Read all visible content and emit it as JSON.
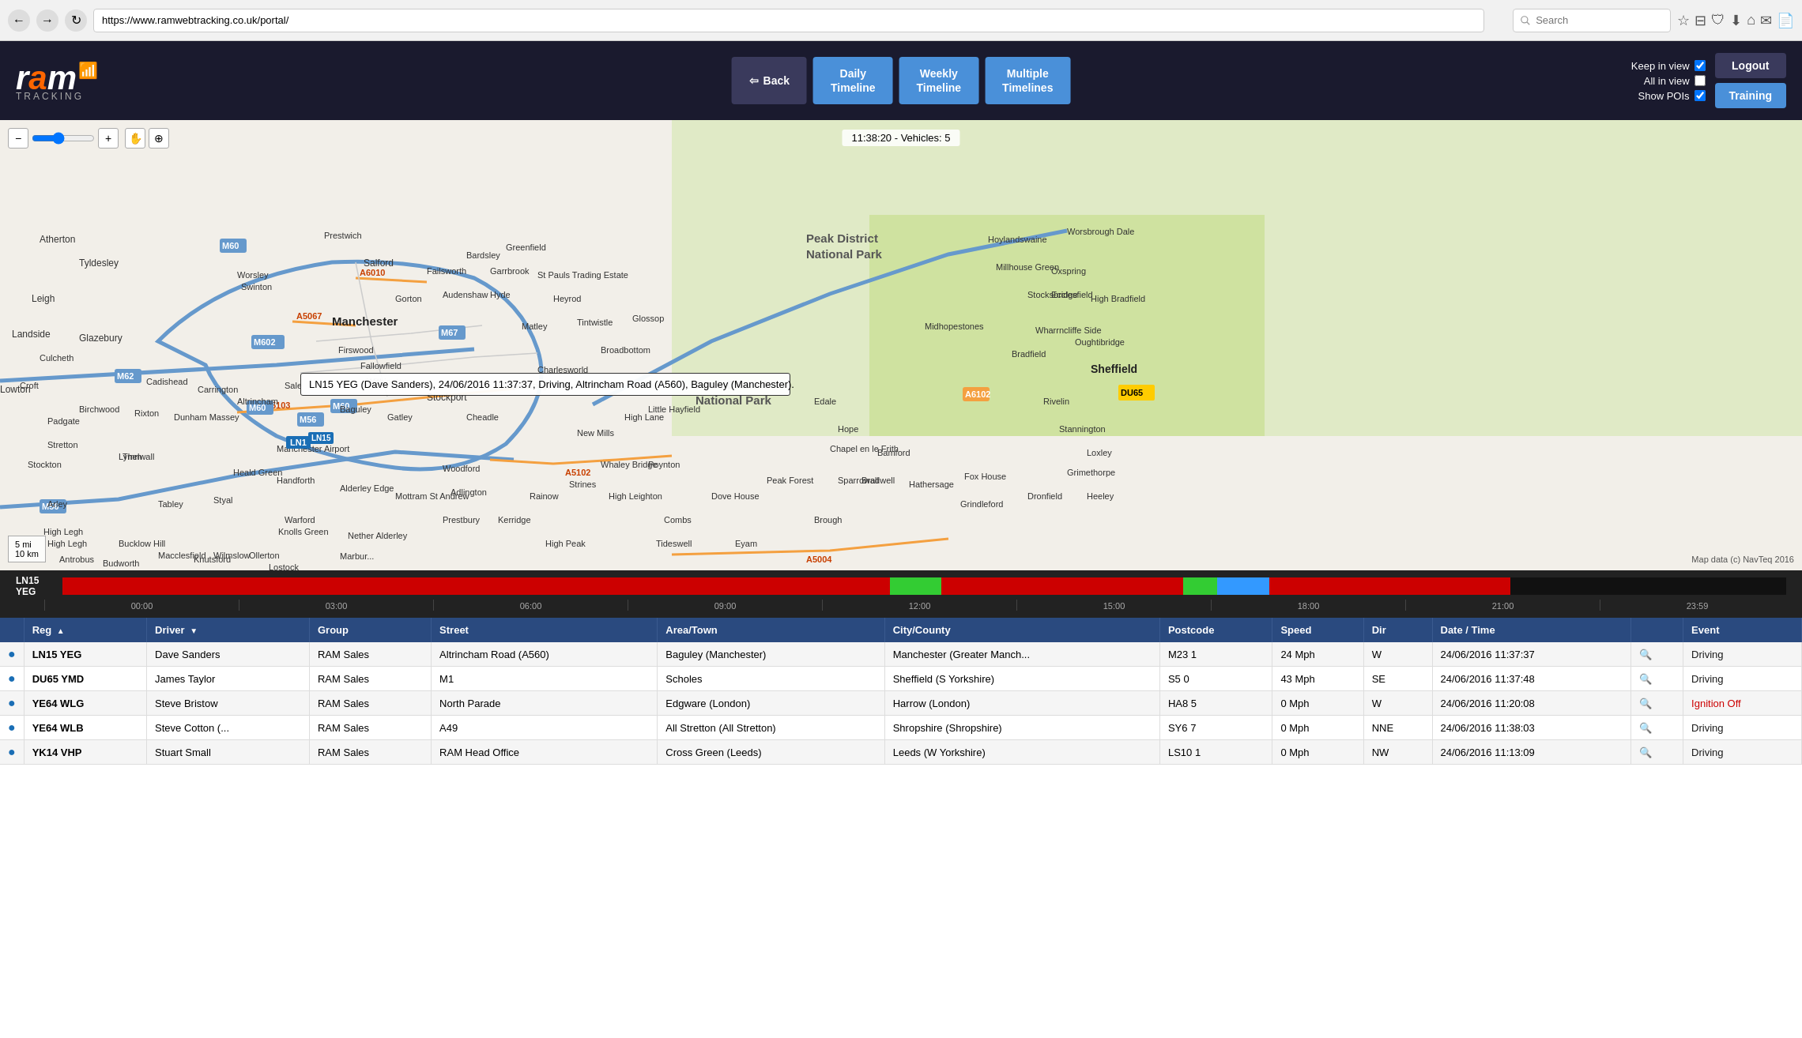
{
  "browser": {
    "url": "https://www.ramwebtracking.co.uk/portal/",
    "search_placeholder": "Search"
  },
  "header": {
    "logo_ram": "ram",
    "logo_tracking": "TRACKING",
    "back_label": "Back",
    "daily_label": "Daily\nTimeline",
    "weekly_label": "Weekly\nTimeline",
    "multiple_label": "Multiple\nTimelines",
    "keep_in_view": "Keep in view",
    "all_in_view": "All in view",
    "show_pois": "Show POIs",
    "logout_label": "Logout",
    "training_label": "Training"
  },
  "status_bar": {
    "text": "11:38:20 - Vehicles: 5"
  },
  "map": {
    "tooltip": "LN15 YEG (Dave Sanders), 24/06/2016 11:37:37, Driving, Altrincham Road (A560), Baguley (Manchester).",
    "tooltip_label": "LN1",
    "vehicle_marker_1": "DU65",
    "vehicle_marker_2": "LN15",
    "scale_text_1": "5 mi",
    "scale_text_2": "10 km",
    "credit": "Map data (c) NavTeq 2016"
  },
  "timeline": {
    "vehicle": "LN15\nYEG",
    "hours": [
      "00:00",
      "03:00",
      "06:00",
      "09:00",
      "12:00",
      "15:00",
      "18:00",
      "21:00",
      "23:59"
    ]
  },
  "table": {
    "columns": [
      "",
      "Reg",
      "Driver",
      "Group",
      "Street",
      "Area/Town",
      "City/County",
      "Postcode",
      "Speed",
      "Dir",
      "Date / Time",
      "",
      "Event"
    ],
    "rows": [
      {
        "icon": "●",
        "reg": "LN15 YEG",
        "driver": "Dave Sanders",
        "group": "RAM Sales",
        "street": "Altrincham Road (A560)",
        "area": "Baguley (Manchester)",
        "city": "Manchester (Greater Manch...",
        "postcode": "M23 1",
        "speed": "24 Mph",
        "dir": "W",
        "datetime": "24/06/2016   11:37:37",
        "speed_icon": "🔍",
        "event": "Driving",
        "event_class": "event-driving"
      },
      {
        "icon": "●",
        "reg": "DU65 YMD",
        "driver": "James Taylor",
        "group": "RAM Sales",
        "street": "M1",
        "area": "Scholes",
        "city": "Sheffield (S Yorkshire)",
        "postcode": "S5 0",
        "speed": "43 Mph",
        "dir": "SE",
        "datetime": "24/06/2016   11:37:48",
        "speed_icon": "🔍",
        "event": "Driving",
        "event_class": "event-driving"
      },
      {
        "icon": "●",
        "reg": "YE64 WLG",
        "driver": "Steve Bristow",
        "group": "RAM Sales",
        "street": "North Parade",
        "area": "Edgware (London)",
        "city": "Harrow (London)",
        "postcode": "HA8 5",
        "speed": "0 Mph",
        "dir": "W",
        "datetime": "24/06/2016   11:20:08",
        "speed_icon": "🔍",
        "event": "Ignition Off",
        "event_class": "event-ignition"
      },
      {
        "icon": "●",
        "reg": "YE64 WLB",
        "driver": "Steve Cotton (...",
        "group": "RAM Sales",
        "street": "A49",
        "area": "All Stretton (All Stretton)",
        "city": "Shropshire (Shropshire)",
        "postcode": "SY6 7",
        "speed": "0 Mph",
        "dir": "NNE",
        "datetime": "24/06/2016   11:38:03",
        "speed_icon": "🔍",
        "event": "Driving",
        "event_class": "event-driving"
      },
      {
        "icon": "●",
        "reg": "YK14 VHP",
        "driver": "Stuart Small",
        "group": "RAM Sales",
        "street": "RAM Head Office",
        "area": "Cross Green (Leeds)",
        "city": "Leeds (W Yorkshire)",
        "postcode": "LS10 1",
        "speed": "0 Mph",
        "dir": "NW",
        "datetime": "24/06/2016   11:13:09",
        "speed_icon": "🔍",
        "event": "Driving",
        "event_class": "event-driving"
      }
    ]
  },
  "colors": {
    "header_bg": "#1a1a2e",
    "nav_btn_bg": "#4a90d9",
    "back_btn_bg": "#3a3a5c",
    "table_header_bg": "#2a4a7f",
    "timeline_bg": "#222",
    "map_bg": "#e8e0d0"
  }
}
